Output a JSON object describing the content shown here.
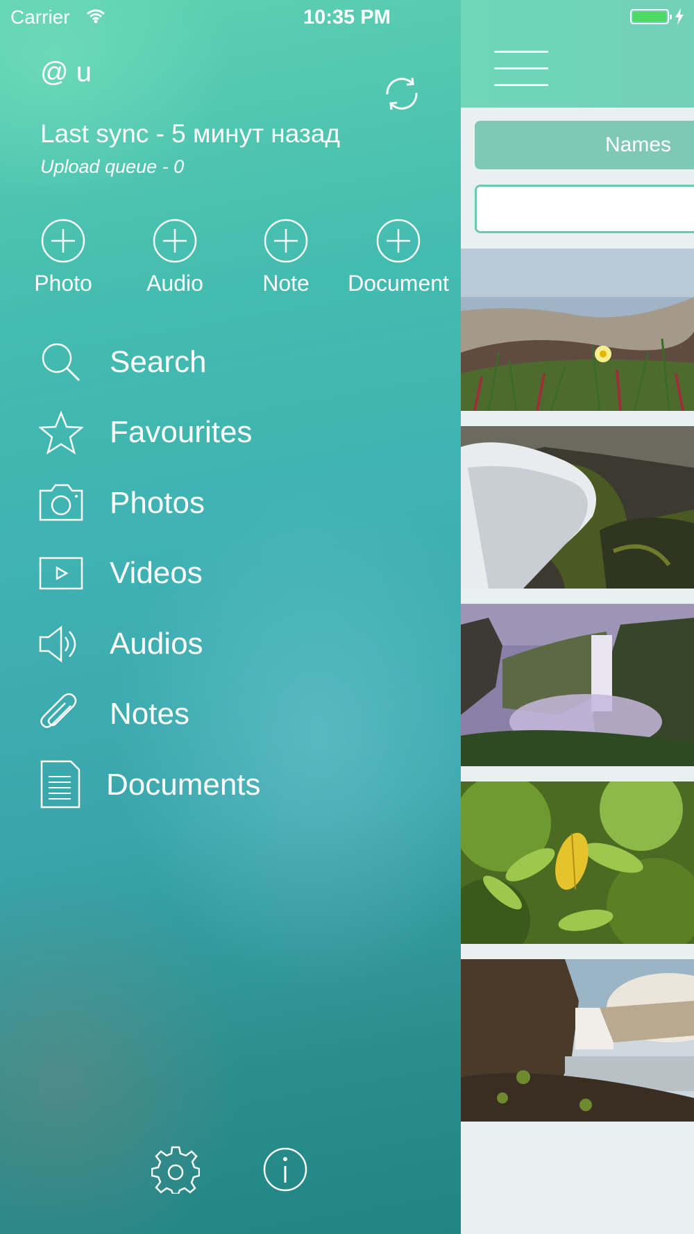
{
  "status_bar": {
    "carrier": "Carrier",
    "time": "10:35 PM"
  },
  "account": {
    "user": "@ u",
    "last_sync": "Last sync - 5 минут назад",
    "upload_queue": "Upload queue - 0"
  },
  "quick_add": [
    {
      "label": "Photo",
      "icon": "plus-circle-icon"
    },
    {
      "label": "Audio",
      "icon": "plus-circle-icon"
    },
    {
      "label": "Note",
      "icon": "plus-circle-icon"
    },
    {
      "label": "Document",
      "icon": "plus-circle-icon"
    }
  ],
  "menu": [
    {
      "label": "Search",
      "icon": "search-icon"
    },
    {
      "label": "Favourites",
      "icon": "star-icon"
    },
    {
      "label": "Photos",
      "icon": "camera-icon"
    },
    {
      "label": "Videos",
      "icon": "play-icon"
    },
    {
      "label": "Audios",
      "icon": "speaker-icon"
    },
    {
      "label": "Notes",
      "icon": "paperclip-icon"
    },
    {
      "label": "Documents",
      "icon": "document-icon"
    }
  ],
  "footer": {
    "settings_icon": "gear-icon",
    "info_icon": "info-icon"
  },
  "main": {
    "sort_label": "Names",
    "search_placeholder": "",
    "thumbnails": [
      {
        "subject": "beach grass with yellow flower"
      },
      {
        "subject": "waterfall over mossy rocks"
      },
      {
        "subject": "waterfall in purple mist"
      },
      {
        "subject": "green leaves with yellow leaf"
      },
      {
        "subject": "waterfall at sunset"
      }
    ]
  },
  "colors": {
    "accent": "#6fd6b8",
    "drawer_top": "#5fd1b1",
    "drawer_bottom": "#1f8585"
  }
}
